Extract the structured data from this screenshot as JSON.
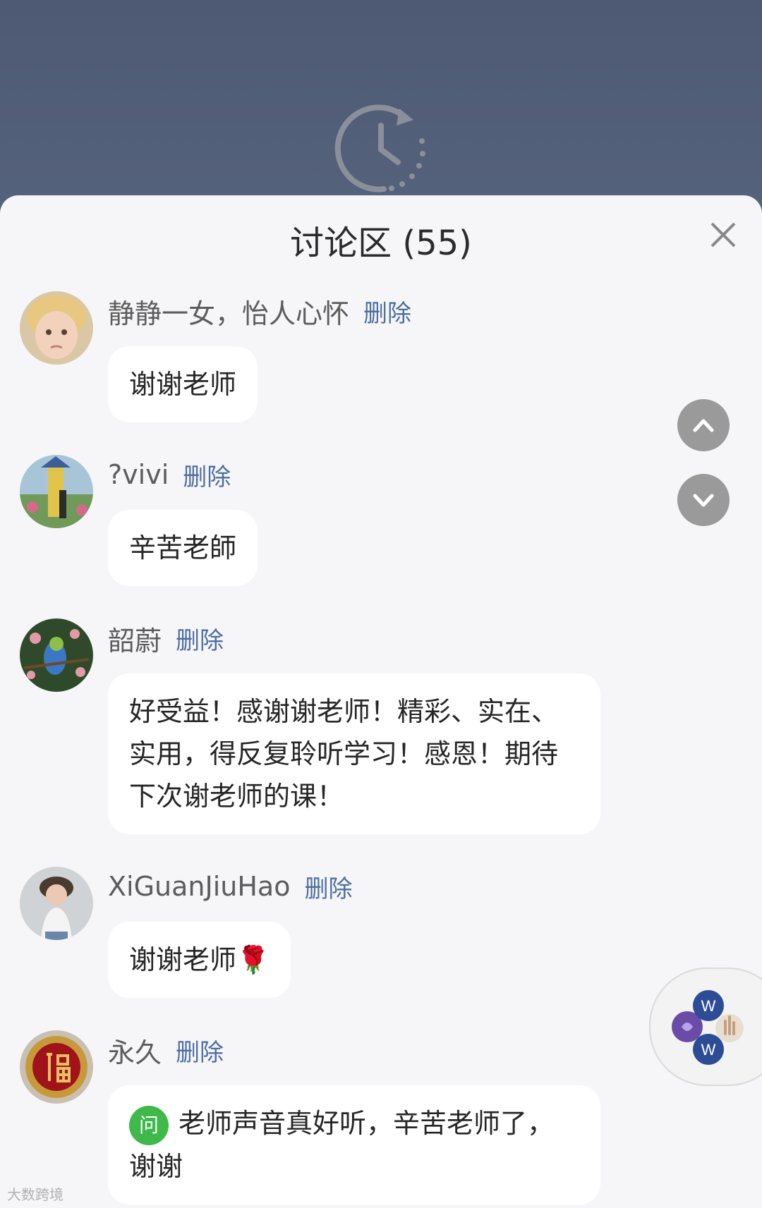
{
  "panel": {
    "title": "讨论区 (55)"
  },
  "comments": [
    {
      "author": "静静一女，怡人心怀",
      "delete_label": "删除",
      "text": "谢谢老师",
      "avatar": "child-portrait-avatar"
    },
    {
      "author": "?vivi",
      "delete_label": "删除",
      "text": "辛苦老師",
      "avatar": "windmill-garden-avatar"
    },
    {
      "author": "韶蔚",
      "delete_label": "删除",
      "text": "好受益！感谢谢老师！精彩、实在、实用，得反复聆听学习！感恩！期待下次谢老师的课！",
      "avatar": "parrot-blossom-avatar"
    },
    {
      "author": "XiGuanJiuHao",
      "delete_label": "删除",
      "text": "谢谢老师🌹",
      "avatar": "woman-portrait-avatar"
    },
    {
      "author": "永久",
      "delete_label": "删除",
      "badge": "问",
      "text": "老师声音真好听，辛苦老师了，谢谢",
      "avatar": "fu-character-avatar"
    }
  ],
  "icons": {
    "replay": "replay-clock-icon",
    "close": "close-icon",
    "scroll_up": "chevron-up-icon",
    "scroll_down": "chevron-down-icon",
    "widget": "app-floating-widget-icon"
  },
  "watermark": "大数跨境",
  "colors": {
    "header_bg": "#4f5d78",
    "panel_bg": "#f6f6f8",
    "delete_link": "#4c6ea0",
    "question_badge": "#3fb94a"
  }
}
